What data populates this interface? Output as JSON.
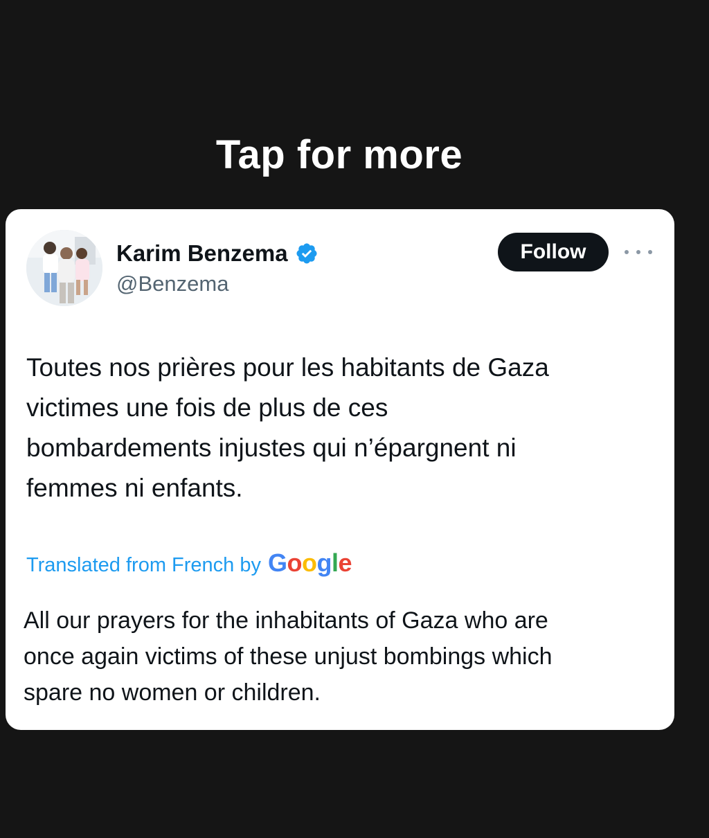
{
  "overlay": {
    "tap_label": "Tap for more"
  },
  "tweet": {
    "author": {
      "display_name": "Karim Benzema",
      "handle": "@Benzema",
      "verified": true,
      "avatar_icon": "profile-photo"
    },
    "follow_label": "Follow",
    "more_icon": "more-horizontal-icon",
    "text": "Toutes nos prières pour les habitants de Gaza\nvictimes une fois de plus de ces\nbombardements injustes qui n’épargnent ni\nfemmes ni enfants.",
    "translation": {
      "label": "Translated from French by",
      "provider": {
        "letters": [
          "G",
          "o",
          "o",
          "g",
          "l",
          "e"
        ],
        "colors": [
          "#4285F4",
          "#EA4335",
          "#FBBC05",
          "#4285F4",
          "#34A853",
          "#EA4335"
        ]
      },
      "text": "All our prayers for the inhabitants of Gaza who are\nonce again victims of these unjust bombings which\nspare no women or children."
    }
  },
  "colors": {
    "background": "#151515",
    "card": "#ffffff",
    "text_primary": "#0f1419",
    "text_secondary": "#536471",
    "link": "#1d9bf0",
    "verified_badge": "#1d9bf0"
  }
}
